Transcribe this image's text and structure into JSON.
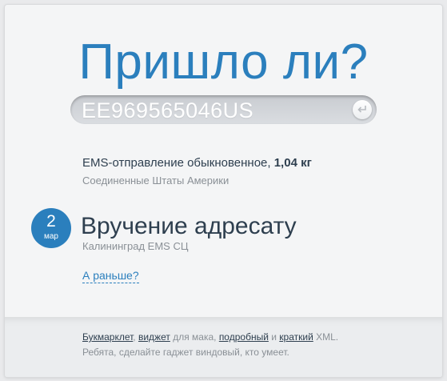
{
  "header": {
    "title": "Пришло ли?"
  },
  "tracking": {
    "number": "EE969565046US",
    "submit_icon": "return-arrow-icon"
  },
  "shipment": {
    "type": "EMS-отправление обыкновенное,",
    "weight": "1,04 кг",
    "country": "Соединенные Штаты Америки"
  },
  "event": {
    "day": "2",
    "month": "мар",
    "status": "Вручение адресату",
    "location": "Калининград EMS СЦ"
  },
  "history_link": "А раньше?",
  "footer": {
    "bookmarklet": "Букмарклет",
    "sep1": ", ",
    "widget": "виджет",
    "text_mac": " для мака, ",
    "detailed": "подробный",
    "text_and": " и ",
    "brief": "краткий",
    "text_xml": " XML.",
    "line2": "Ребята, сделайте гаджет виндовый, кто умеет."
  },
  "colors": {
    "accent": "#2b7fbd",
    "text_dark": "#2e3f4f",
    "text_muted": "#8a9096"
  }
}
